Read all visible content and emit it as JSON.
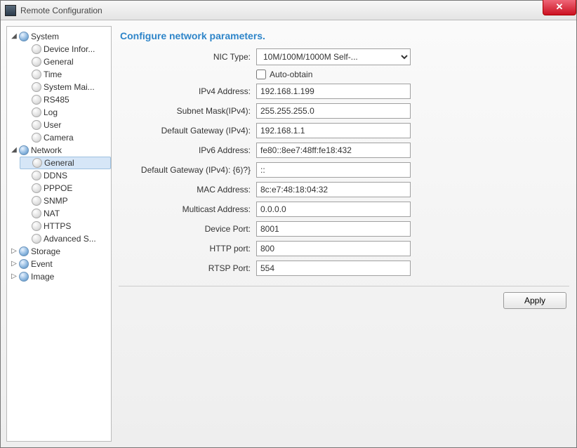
{
  "window": {
    "title": "Remote Configuration",
    "close_symbol": "✕"
  },
  "sidebar": {
    "system": {
      "label": "System",
      "expanded": true,
      "children": [
        {
          "label": "Device Infor..."
        },
        {
          "label": "General"
        },
        {
          "label": "Time"
        },
        {
          "label": "System Mai..."
        },
        {
          "label": "RS485"
        },
        {
          "label": "Log"
        },
        {
          "label": "User"
        },
        {
          "label": "Camera"
        }
      ]
    },
    "network": {
      "label": "Network",
      "expanded": true,
      "children": [
        {
          "label": "General",
          "selected": true
        },
        {
          "label": "DDNS"
        },
        {
          "label": "PPPOE"
        },
        {
          "label": "SNMP"
        },
        {
          "label": "NAT"
        },
        {
          "label": "HTTPS"
        },
        {
          "label": "Advanced S..."
        }
      ]
    },
    "storage": {
      "label": "Storage",
      "expanded": false
    },
    "event": {
      "label": "Event",
      "expanded": false
    },
    "image": {
      "label": "Image",
      "expanded": false
    }
  },
  "main": {
    "heading": "Configure network parameters.",
    "fields": {
      "nic_type": {
        "label": "NIC Type:",
        "value": "10M/100M/1000M Self-..."
      },
      "auto_obtain": {
        "label": "Auto-obtain",
        "checked": false
      },
      "ipv4_address": {
        "label": "IPv4 Address:",
        "value": "192.168.1.199"
      },
      "subnet_mask_v4": {
        "label": "Subnet Mask(IPv4):",
        "value": "255.255.255.0"
      },
      "default_gw_v4": {
        "label": "Default Gateway (IPv4):",
        "value": "192.168.1.1"
      },
      "ipv6_address": {
        "label": "IPv6 Address:",
        "value": "fe80::8ee7:48ff:fe18:432"
      },
      "default_gw_v4_alt": {
        "label": "Default Gateway (IPv4): {6)?}",
        "value": "::"
      },
      "mac_address": {
        "label": "MAC Address:",
        "value": "8c:e7:48:18:04:32"
      },
      "multicast_address": {
        "label": "Multicast Address:",
        "value": "0.0.0.0"
      },
      "device_port": {
        "label": "Device Port:",
        "value": "8001"
      },
      "http_port": {
        "label": "HTTP port:",
        "value": "800"
      },
      "rtsp_port": {
        "label": "RTSP Port:",
        "value": "554"
      }
    },
    "apply_label": "Apply"
  }
}
